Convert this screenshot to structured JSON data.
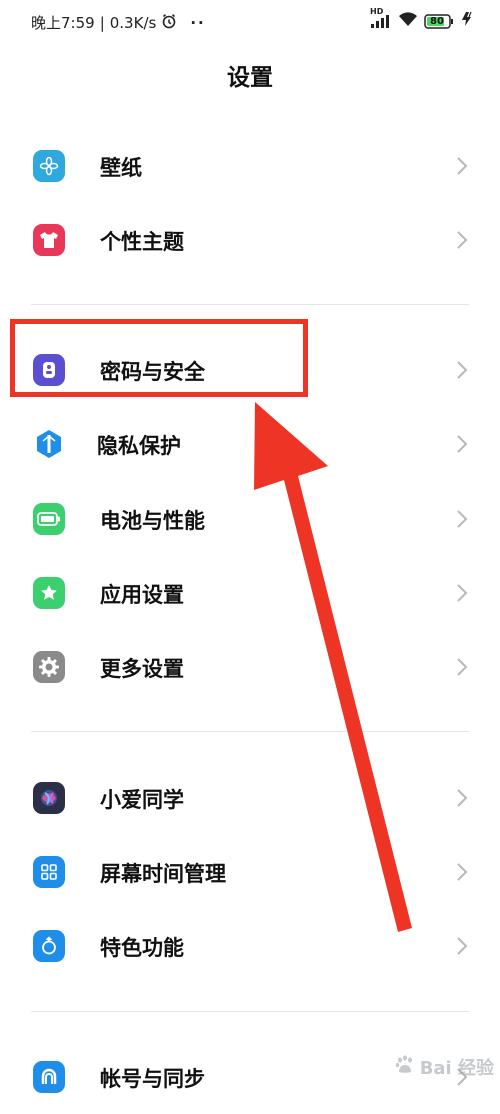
{
  "status_bar": {
    "time": "晚上7:59",
    "separator": "|",
    "speed": "0.3K/s",
    "more": "··",
    "hd_label": "HD",
    "battery": "80"
  },
  "page_title": "设置",
  "groups": [
    [
      {
        "label": "壁纸",
        "icon": "wallpaper-icon",
        "color": "#2fa8dd"
      },
      {
        "label": "个性主题",
        "icon": "theme-shirt-icon",
        "color": "#e8385a"
      }
    ],
    [
      {
        "label": "密码与安全",
        "icon": "password-security-icon",
        "color": "#5b4fd0"
      },
      {
        "label": "隐私保护",
        "icon": "privacy-icon",
        "color": "#1f8ee8"
      },
      {
        "label": "电池与性能",
        "icon": "battery-icon",
        "color": "#3ccf6e"
      },
      {
        "label": "应用设置",
        "icon": "app-settings-star-icon",
        "color": "#3ccf6e"
      },
      {
        "label": "更多设置",
        "icon": "gear-icon",
        "color": "#8a8a8a"
      }
    ],
    [
      {
        "label": "小爱同学",
        "icon": "xiaoai-assistant-icon",
        "color": "#2b2f48"
      },
      {
        "label": "屏幕时间管理",
        "icon": "screen-time-icon",
        "color": "#1f8ee8"
      },
      {
        "label": "特色功能",
        "icon": "special-features-icon",
        "color": "#1f8ee8"
      }
    ],
    [
      {
        "label": "帐号与同步",
        "icon": "account-sync-icon",
        "color": "#1f8ee8"
      }
    ]
  ],
  "annotation": {
    "color": "#ee3424"
  },
  "watermark": {
    "text": "Bai 经验"
  }
}
